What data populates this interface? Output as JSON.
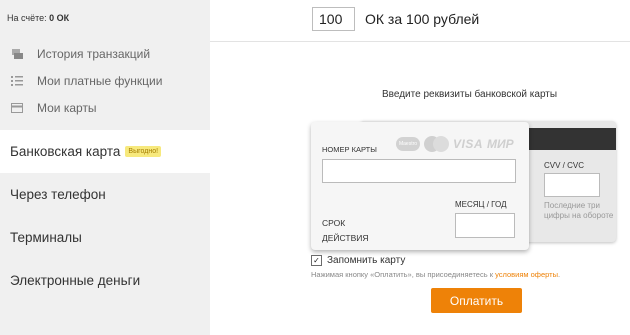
{
  "balance": {
    "label": "На счёте:",
    "value": "0 ОК"
  },
  "menu": [
    {
      "label": "История транзакций",
      "icon": "history-icon"
    },
    {
      "label": "Мои платные функции",
      "icon": "list-icon"
    },
    {
      "label": "Мои карты",
      "icon": "card-icon"
    }
  ],
  "payment_methods": [
    {
      "label": "Банковская карта",
      "badge": "Выгодно!",
      "active": true
    },
    {
      "label": "Через телефон"
    },
    {
      "label": "Терминалы"
    },
    {
      "label": "Электронные деньги"
    }
  ],
  "amount": {
    "value": "100",
    "label": "ОК за 100 рублей"
  },
  "card_form": {
    "prompt": "Введите реквизиты банковской карты",
    "number_label": "НОМЕР КАРТЫ",
    "month_label": "МЕСЯЦ / ГОД",
    "expiry_label": "СРОК ДЕЙСТВИЯ",
    "cvv_label": "CVV / CVC",
    "cvv_hint": "Последние три цифры на обороте",
    "logos": {
      "maestro": "Maestro",
      "visa": "VISA",
      "mir": "МИР"
    }
  },
  "remember_card": {
    "label": "Запомнить карту",
    "checked": true
  },
  "terms": {
    "text": "Нажимая кнопку «Оплатить», вы присоединяетесь к",
    "link": "условиям оферты",
    "suffix": "."
  },
  "pay_button": {
    "label": "Оплатить"
  },
  "colors": {
    "accent": "#ee8208",
    "sidebar_bg": "#f0f0f0",
    "badge_bg": "#f7e97d"
  }
}
